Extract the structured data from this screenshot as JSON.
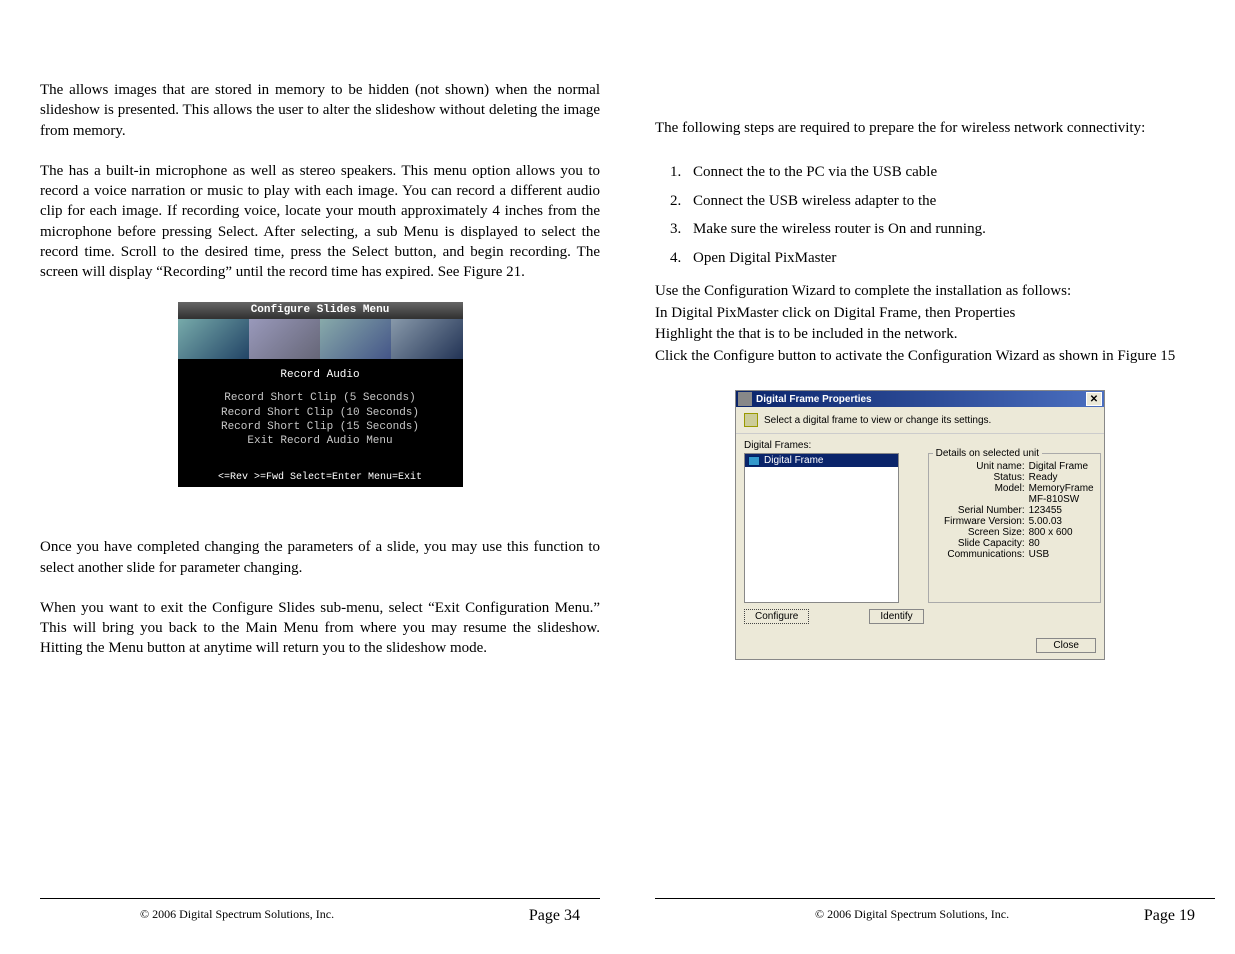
{
  "left": {
    "p1": "The                           allows images that are stored in memory to be hidden (not shown) when the normal slideshow is presented.  This allows the user to alter the slideshow without deleting the image from memory.",
    "p2": "The                           has a built-in microphone as well as stereo speakers.  This menu option allows you to record a voice narration or music to play with each image.   You can record a different audio clip for each image. If recording voice, locate your mouth approximately 4 inches from the microphone before pressing Select. After selecting, a sub Menu is displayed to select the record time. Scroll to the desired time, press the Select button, and begin recording. The screen will display “Recording” until the record time has expired. See Figure 21.",
    "p3": "Once you have completed changing the parameters of a slide, you may use this function to select another slide for parameter changing.",
    "p4": "When you want to exit the Configure Slides sub-menu, select “Exit Configuration Menu.”  This will bring you back to the Main Menu from where you may resume the slideshow.  Hitting the Menu button at anytime will return you to the slideshow mode.",
    "fig": {
      "title": "Configure Slides Menu",
      "sub": "Record Audio",
      "opts": [
        "Record Short Clip (5 Seconds)",
        "Record Short Clip (10 Seconds)",
        "Record Short Clip (15 Seconds)",
        "Exit Record Audio Menu"
      ],
      "foot": "<=Rev >=Fwd Select=Enter Menu=Exit"
    }
  },
  "right": {
    "intro": "The following steps are required to prepare the                              for wireless network connectivity:",
    "steps": [
      "Connect the                              to the PC via the USB cable",
      "Connect the USB wireless adapter to the",
      "Make sure the wireless router is On and running.",
      "Open Digital PixMaster"
    ],
    "follow": [
      "Use the Configuration Wizard to complete the installation as follows:",
      "In Digital PixMaster click on Digital Frame, then Properties",
      "Highlight the                              that is to be included in the network.",
      "Click the Configure button to activate the Configuration Wizard as shown in Figure 15"
    ]
  },
  "dialog": {
    "title": "Digital Frame Properties",
    "sub": "Select a digital frame to view or change its settings.",
    "framesLabel": "Digital Frames:",
    "frameItem": "Digital Frame",
    "detailsLegend": "Details on selected unit",
    "kv": {
      "k0": "Unit name:",
      "v0": "Digital Frame",
      "k1": "Status:",
      "v1": "Ready",
      "k2": "Model:",
      "v2": "MemoryFrame MF-810SW",
      "k3": "Serial Number:",
      "v3": "123455",
      "k4": "Firmware Version:",
      "v4": "5.00.03",
      "k5": "Screen Size:",
      "v5": "800 x 600",
      "k6": "Slide Capacity:",
      "v6": "80",
      "k7": "Communications:",
      "v7": "USB"
    },
    "btnConfigure": "Configure",
    "btnIdentify": "Identify",
    "btnClose": "Close"
  },
  "footer": {
    "copy": "© 2006 Digital Spectrum Solutions, Inc.",
    "leftNum": "Page 34",
    "rightNum": "Page 19"
  }
}
